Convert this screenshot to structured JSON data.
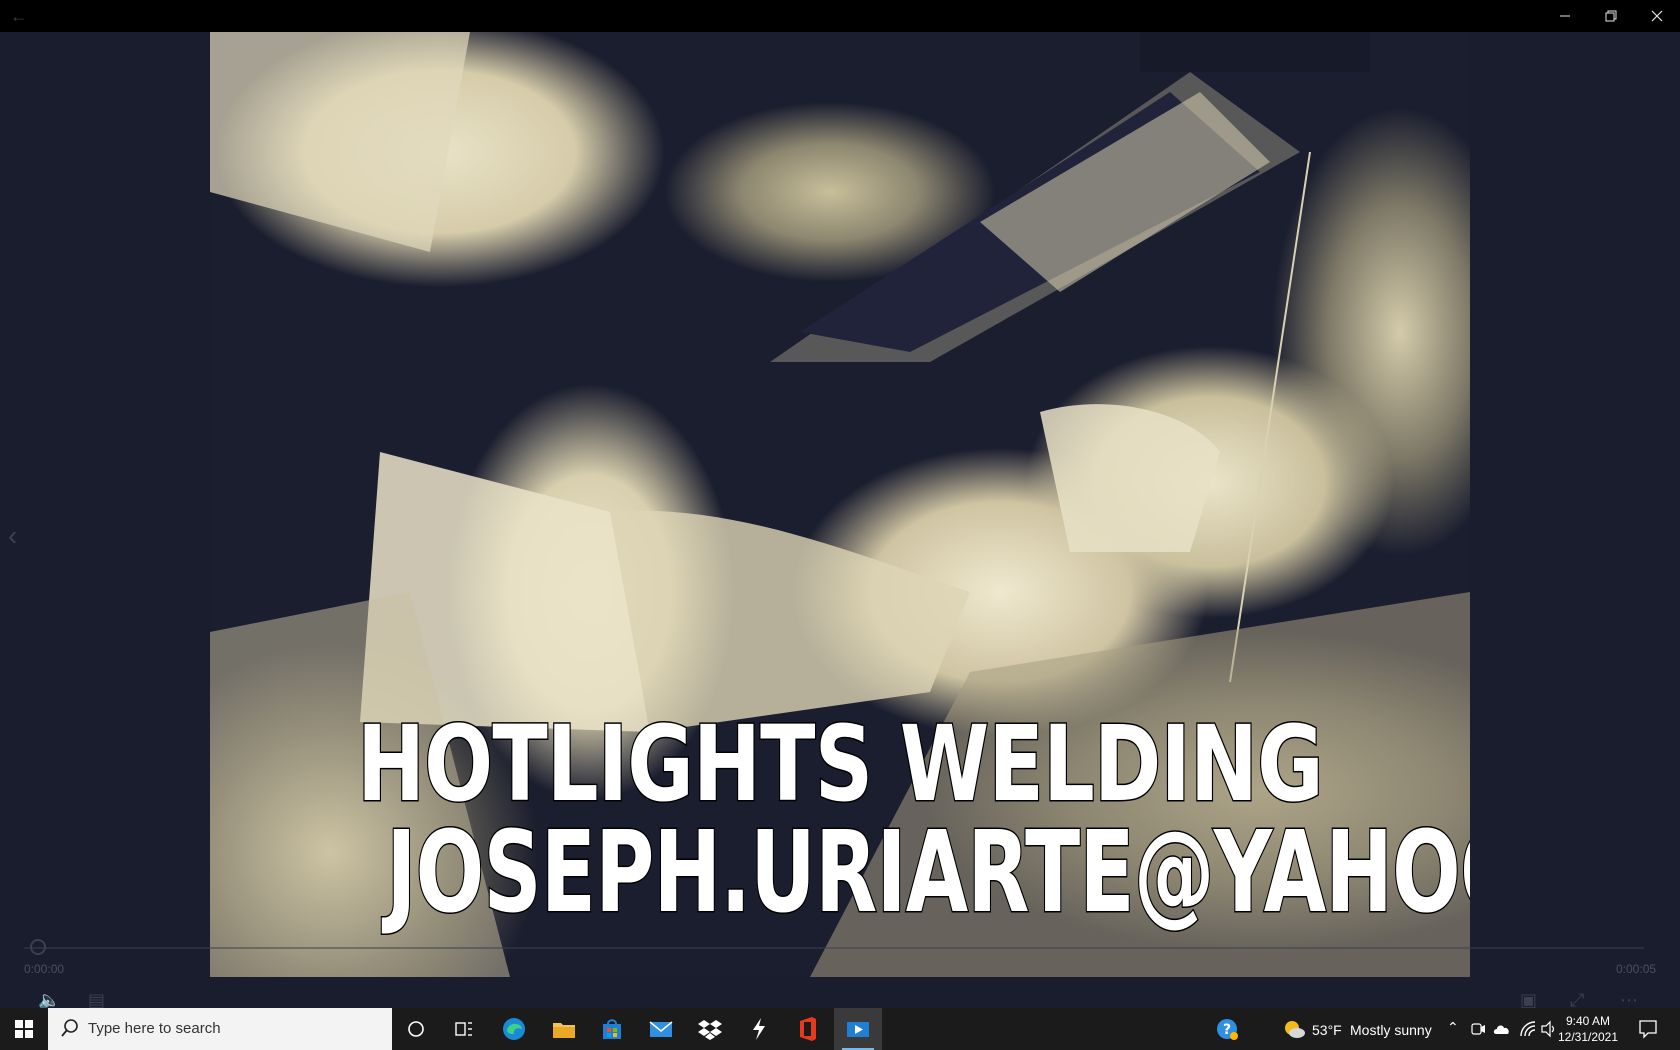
{
  "window": {
    "back_icon": "back-arrow-icon",
    "minimize_icon": "minimize-icon",
    "restore_icon": "restore-icon",
    "close_icon": "close-icon"
  },
  "video": {
    "caption_line1": "HOTLIGHTS WELDING",
    "caption_line2": "JOSEPH.URIARTE@YAHOO"
  },
  "player": {
    "elapsed": "0:00:00",
    "duration": "0:00:05",
    "progress": 0.0
  },
  "taskbar": {
    "search_placeholder": "Type here to search",
    "weather_temp": "53°F",
    "weather_desc": "Mostly sunny",
    "time": "9:40 AM",
    "date": "12/31/2021"
  },
  "colors": {
    "taskbar_bg": "#1b1b1b",
    "player_bg": "#1a1d2e",
    "accent": "#76b9ed"
  }
}
